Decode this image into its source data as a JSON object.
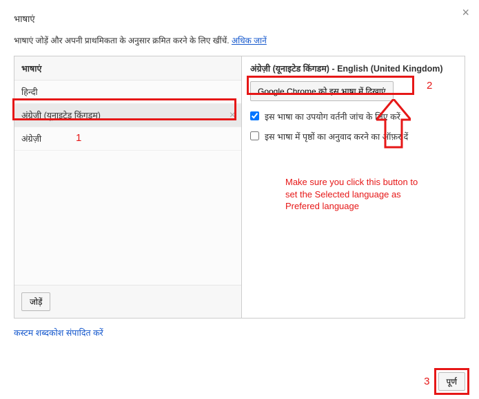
{
  "header": {
    "title": "भाषाएं",
    "subtitle_prefix": "भाषाएं जोड़ें और अपनी प्राथमिकता के अनुसार क्रमित करने के लिए खींचें. ",
    "learn_more": "अधिक जानें"
  },
  "left_panel": {
    "header": "भाषाएं",
    "items": [
      {
        "label": "हिन्दी",
        "selected": false
      },
      {
        "label": "अंग्रेज़ी (यूनाइटेड किंगडम)",
        "selected": true
      },
      {
        "label": "अंग्रेज़ी",
        "selected": false
      }
    ],
    "add_button": "जोड़ें"
  },
  "right_panel": {
    "title": "अंग्रेज़ी (यूनाइटेड किंगडम) - English (United Kingdom)",
    "display_button": "Google Chrome को इस भाषा में दिखाएं",
    "spellcheck_label": "इस भाषा का उपयोग वर्तनी जांच के लिए करें",
    "spellcheck_checked": true,
    "translate_label": "इस भाषा में पृष्ठों का अनुवाद करने का ऑफ़र दें",
    "translate_checked": false
  },
  "footer": {
    "custom_dict_link": "कस्टम शब्दकोश संपादित करें",
    "done_button": "पूर्ण"
  },
  "annotations": {
    "num1": "1",
    "num2": "2",
    "num3": "3",
    "note": "Make sure you click this button to set the Selected language as Prefered language"
  }
}
